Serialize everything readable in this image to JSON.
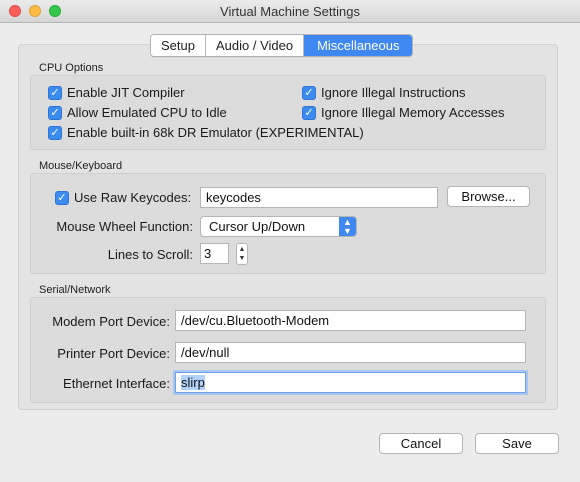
{
  "window": {
    "title": "Virtual Machine Settings"
  },
  "tabs": [
    {
      "label": "Setup",
      "active": false
    },
    {
      "label": "Audio / Video",
      "active": false
    },
    {
      "label": "Miscellaneous",
      "active": true
    }
  ],
  "cpu_options": {
    "section_label": "CPU Options",
    "enable_jit": {
      "label": "Enable JIT Compiler",
      "checked": true
    },
    "ignore_illegal_instructions": {
      "label": "Ignore Illegal Instructions",
      "checked": true
    },
    "allow_idle": {
      "label": "Allow Emulated CPU to Idle",
      "checked": true
    },
    "ignore_illegal_memory": {
      "label": "Ignore Illegal Memory Accesses",
      "checked": true
    },
    "dr_emulator": {
      "label": "Enable built-in 68k DR Emulator (EXPERIMENTAL)",
      "checked": true
    }
  },
  "mouse_keyboard": {
    "section_label": "Mouse/Keyboard",
    "raw_keycodes": {
      "label": "Use Raw Keycodes:",
      "checked": true
    },
    "keycodes_value": "keycodes",
    "browse_label": "Browse...",
    "wheel_label": "Mouse Wheel Function:",
    "wheel_value": "Cursor Up/Down",
    "lines_label": "Lines to Scroll:",
    "lines_value": "3"
  },
  "serial_network": {
    "section_label": "Serial/Network",
    "modem_label": "Modem Port Device:",
    "modem_value": "/dev/cu.Bluetooth-Modem",
    "printer_label": "Printer Port Device:",
    "printer_value": "/dev/null",
    "ethernet_label": "Ethernet Interface:",
    "ethernet_value": "slirp"
  },
  "footer": {
    "cancel_label": "Cancel",
    "save_label": "Save"
  },
  "icons": {
    "checkmark": "checkmark-icon",
    "popup_arrows": "up-down-arrows-icon",
    "stepper": "stepper-arrows-icon"
  },
  "colors": {
    "accent": "#3f88f1",
    "close": "#fc605c",
    "minimize": "#fdbc40",
    "zoom": "#34c84a"
  }
}
